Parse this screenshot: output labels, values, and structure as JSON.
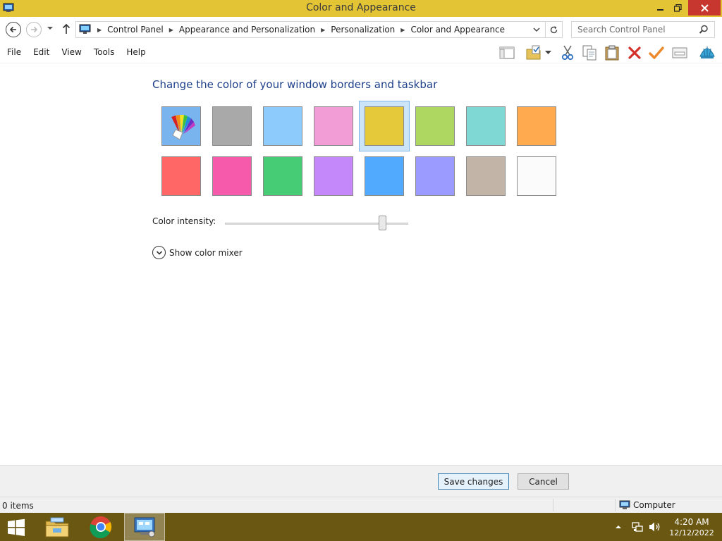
{
  "window": {
    "title": "Color and Appearance"
  },
  "address_bar": {
    "crumbs": [
      "Control Panel",
      "Appearance and Personalization",
      "Personalization",
      "Color and Appearance"
    ],
    "search_placeholder": "Search Control Panel"
  },
  "menu": {
    "items": [
      "File",
      "Edit",
      "View",
      "Tools",
      "Help"
    ]
  },
  "toolbar": {
    "icons": [
      "layout-icon",
      "folder-check-icon",
      "dropdown-icon",
      "cut-icon",
      "copy-icon",
      "paste-icon",
      "delete-icon",
      "checkmark-icon",
      "properties-icon",
      "shell-icon"
    ]
  },
  "main": {
    "heading": "Change the color of your window borders and taskbar",
    "selected_swatch": 4,
    "swatches": [
      {
        "name": "automatic",
        "color": "#7ab4ee"
      },
      {
        "name": "gray",
        "color": "#a9a9a9"
      },
      {
        "name": "sky",
        "color": "#8ccbfb"
      },
      {
        "name": "pink",
        "color": "#f29dd6"
      },
      {
        "name": "yellow",
        "color": "#e5c93a"
      },
      {
        "name": "lime",
        "color": "#add761"
      },
      {
        "name": "teal",
        "color": "#7fd8d3"
      },
      {
        "name": "orange",
        "color": "#ffaa4f"
      },
      {
        "name": "red",
        "color": "#ff6666"
      },
      {
        "name": "magenta",
        "color": "#f55aab"
      },
      {
        "name": "green",
        "color": "#46cc74"
      },
      {
        "name": "purple",
        "color": "#c588fb"
      },
      {
        "name": "blue",
        "color": "#52aaff"
      },
      {
        "name": "periwinkle",
        "color": "#9b9bff"
      },
      {
        "name": "taupe",
        "color": "#c2b5a8"
      },
      {
        "name": "white",
        "color": "#fbfbfb"
      }
    ],
    "intensity_label": "Color intensity:",
    "intensity_level": 0.85,
    "mixer_label": "Show color mixer"
  },
  "footer": {
    "save_label": "Save changes",
    "cancel_label": "Cancel"
  },
  "status": {
    "items_text": "0 items",
    "location": "Computer"
  },
  "taskbar": {
    "time": "4:20 AM",
    "date": "12/12/2022",
    "accent": "#6a5711"
  }
}
